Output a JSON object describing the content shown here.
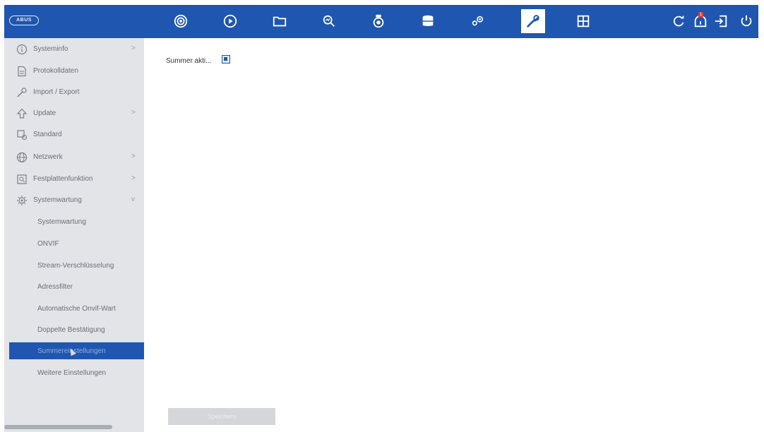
{
  "topbar": {
    "logo": "ABUS",
    "alarm_count": "1",
    "icons": [
      {
        "name": "live-view-icon"
      },
      {
        "name": "playback-icon"
      },
      {
        "name": "files-icon"
      },
      {
        "name": "smart-search-icon"
      },
      {
        "name": "camera-icon"
      },
      {
        "name": "storage-icon"
      },
      {
        "name": "configuration-icon"
      },
      {
        "name": "maintenance-icon",
        "active": true
      },
      {
        "name": "layout-icon"
      }
    ],
    "accent_color": "#1e56b0"
  },
  "sidebar": {
    "items": [
      {
        "label": "Systeminfo",
        "arrow": ">"
      },
      {
        "label": "Protokolldaten",
        "arrow": ""
      },
      {
        "label": "Import / Export",
        "arrow": ""
      },
      {
        "label": "Update",
        "arrow": ">"
      },
      {
        "label": "Standard",
        "arrow": ""
      },
      {
        "label": "Netzwerk",
        "arrow": ">"
      },
      {
        "label": "Festplattenfunktion",
        "arrow": ">"
      },
      {
        "label": "Systemwartung",
        "arrow": "v"
      }
    ],
    "subitems": [
      {
        "label": "Systemwartung"
      },
      {
        "label": "ONVIF"
      },
      {
        "label": "Stream-Verschlüsselung"
      },
      {
        "label": "Adressfilter"
      },
      {
        "label": "Automatische Onvif-Wart"
      },
      {
        "label": "Doppelte Bestätigung"
      },
      {
        "label": "Summereinstellungen",
        "selected": true
      },
      {
        "label": "Weitere Einstellungen"
      }
    ]
  },
  "content": {
    "field_label": "Summer akti...",
    "checkbox_checked": true,
    "save_label": "Speichern"
  }
}
